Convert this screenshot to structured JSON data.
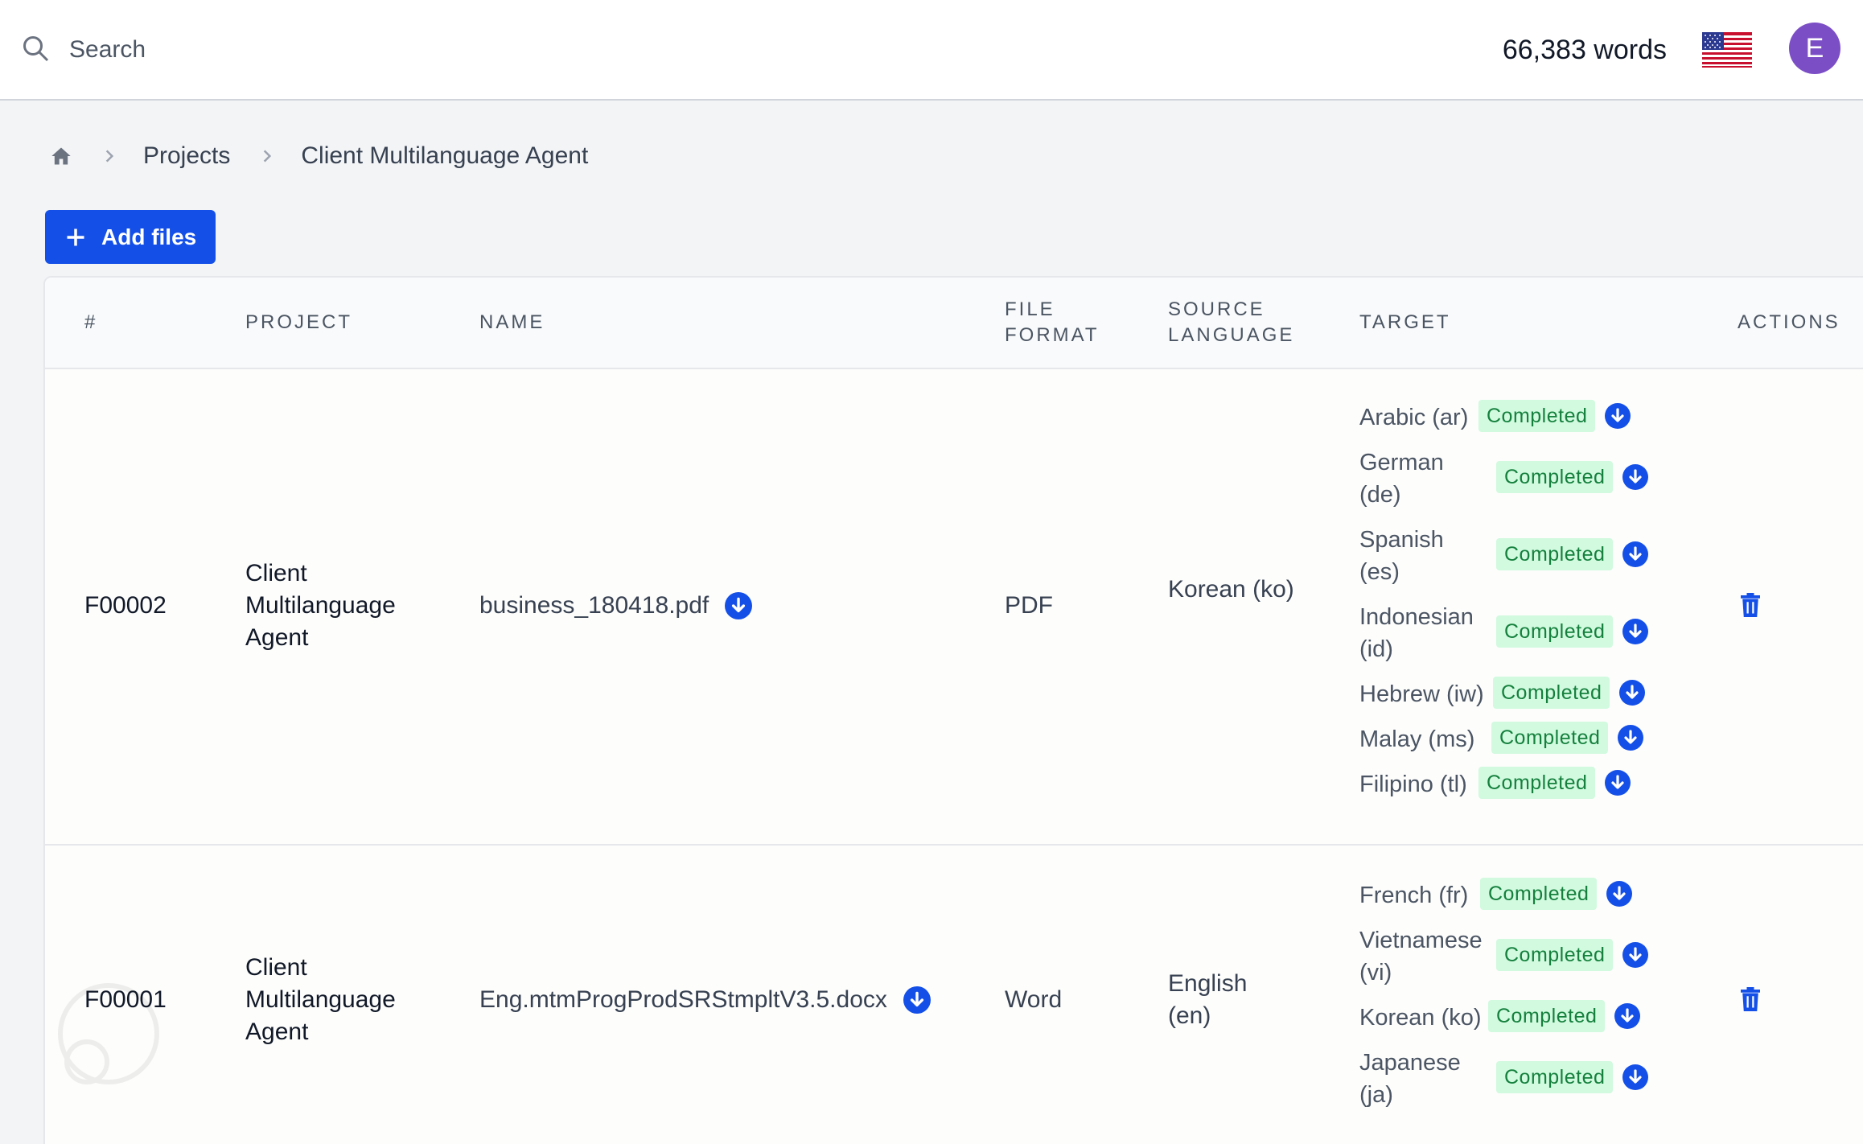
{
  "search": {
    "placeholder": "Search"
  },
  "header": {
    "word_count": "66,383 words",
    "avatar_initial": "E"
  },
  "breadcrumb": {
    "items": [
      "Projects",
      "Client Multilanguage Agent"
    ]
  },
  "toolbar": {
    "add_files_label": "Add files"
  },
  "table": {
    "headers": {
      "num": "#",
      "project": "Project",
      "name": "Name",
      "file_format": "File\nformat",
      "source_language": "Source\nlanguage",
      "target": "Target",
      "actions": "Actions"
    },
    "rows": [
      {
        "id": "F00002",
        "project": "Client Multilanguage Agent",
        "name": "business_180418.pdf",
        "format": "PDF",
        "source": "Korean (ko)",
        "targets": [
          {
            "lang": "Arabic (ar)",
            "status": "Completed"
          },
          {
            "lang": "German (de)",
            "status": "Completed"
          },
          {
            "lang": "Spanish (es)",
            "status": "Completed"
          },
          {
            "lang": "Indonesian (id)",
            "status": "Completed"
          },
          {
            "lang": "Hebrew (iw)",
            "status": "Completed"
          },
          {
            "lang": "Malay (ms)",
            "status": "Completed"
          },
          {
            "lang": "Filipino (tl)",
            "status": "Completed"
          }
        ]
      },
      {
        "id": "F00001",
        "project": "Client Multilanguage Agent",
        "name": "Eng.mtmProgProdSRStmpltV3.5.docx",
        "format": "Word",
        "source": "English (en)",
        "targets": [
          {
            "lang": "French (fr)",
            "status": "Completed"
          },
          {
            "lang": "Vietnamese (vi)",
            "status": "Completed"
          },
          {
            "lang": "Korean (ko)",
            "status": "Completed"
          },
          {
            "lang": "Japanese (ja)",
            "status": "Completed"
          }
        ]
      }
    ]
  },
  "colors": {
    "accent": "#1450e8",
    "badge_bg": "#d1fadf",
    "badge_text": "#15803d",
    "avatar": "#7c4ec6"
  }
}
